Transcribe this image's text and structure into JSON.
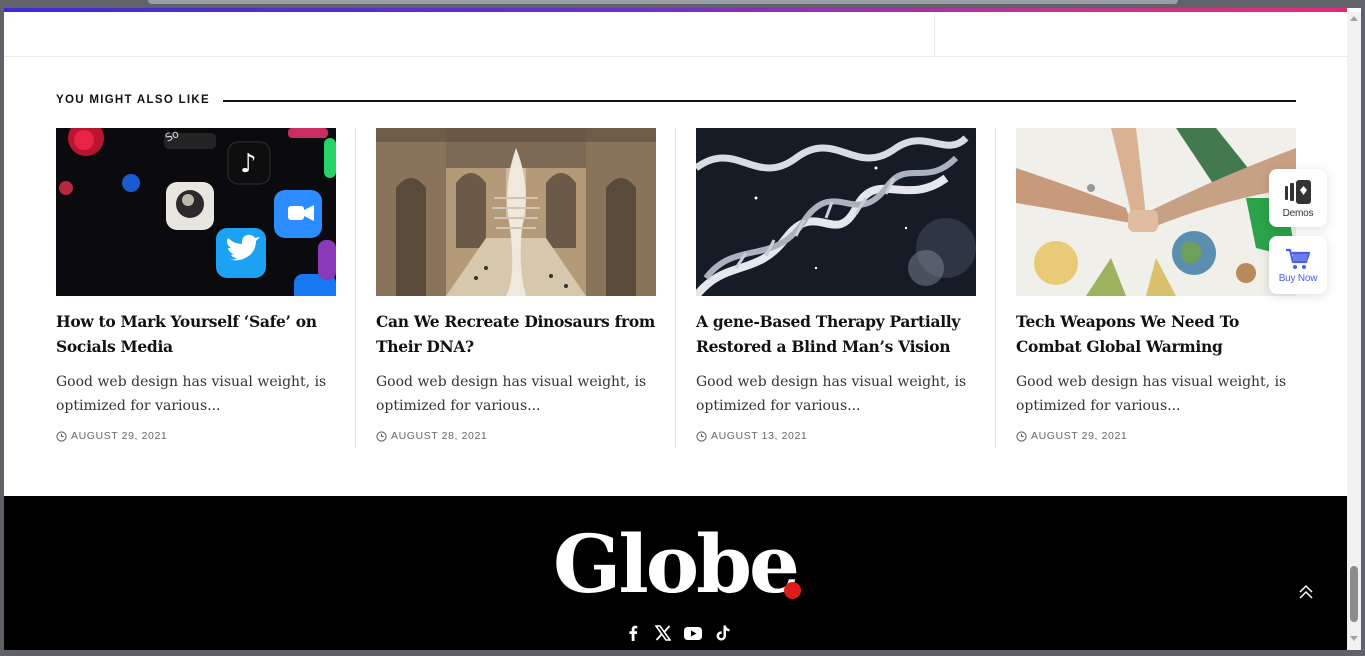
{
  "related": {
    "heading": "YOU MIGHT ALSO LIKE",
    "posts": [
      {
        "title": "How to Mark Yourself ‘Safe’ on Socials Media",
        "excerpt": "Good web design has visual weight, is optimized for various...",
        "date": "AUGUST 29, 2021",
        "image": "social-media-apps-on-phone"
      },
      {
        "title": "Can We Recreate Dinosaurs from Their DNA?",
        "excerpt": "Good web design has visual weight, is optimized for various...",
        "date": "AUGUST 28, 2021",
        "image": "museum-hall-whale-skeleton"
      },
      {
        "title": "A gene-Based Therapy Partially Restored a Blind Man’s Vision",
        "excerpt": "Good web design has visual weight, is optimized for various...",
        "date": "AUGUST 13, 2021",
        "image": "dna-double-helix"
      },
      {
        "title": "Tech Weapons We Need To Combat Global Warming",
        "excerpt": "Good web design has visual weight, is optimized for various...",
        "date": "AUGUST 29, 2021",
        "image": "stacked-hands-over-globe"
      }
    ]
  },
  "widgets": {
    "demos_label": "Demos",
    "buy_label": "Buy Now"
  },
  "footer": {
    "logo_text": "Globe",
    "social_icons": [
      "facebook-icon",
      "x-icon",
      "youtube-icon",
      "tiktok-icon"
    ]
  },
  "colors": {
    "gradient_start": "#3b2bd9",
    "gradient_end": "#e8287a",
    "logo_dot": "#e01b1b",
    "buy_now": "#4a5fe0"
  }
}
